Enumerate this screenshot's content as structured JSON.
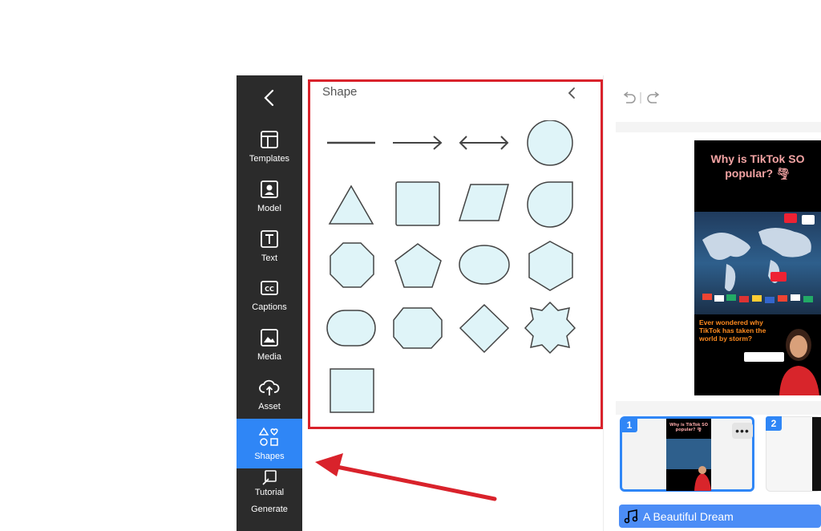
{
  "sidebar": {
    "items": [
      {
        "label": "Templates",
        "icon": "layout-icon"
      },
      {
        "label": "Model",
        "icon": "person-icon"
      },
      {
        "label": "Text",
        "icon": "text-icon"
      },
      {
        "label": "Captions",
        "icon": "captions-icon"
      },
      {
        "label": "Media",
        "icon": "image-icon"
      },
      {
        "label": "Asset",
        "icon": "upload-cloud-icon"
      },
      {
        "label": "Shapes",
        "icon": "shapes-icon",
        "active": true
      },
      {
        "label": "Tutorial",
        "icon": "tutorial-icon"
      },
      {
        "label": "Generate",
        "icon": "generate-icon"
      }
    ]
  },
  "panel": {
    "title": "Shape",
    "shapes": [
      "line",
      "arrow",
      "double-arrow",
      "circle",
      "triangle",
      "square",
      "parallelogram",
      "teardrop",
      "octagon",
      "pentagon",
      "ellipse",
      "hexagon",
      "rounded-rectangle",
      "stretched-hexagon",
      "diamond",
      "starburst",
      "square-2"
    ]
  },
  "editor": {
    "slide": {
      "title": "Why is TikTok SO popular? 🌪",
      "subtitle": "Ever wondered why TikTok has taken the world by storm?"
    },
    "thumbnails": [
      {
        "number": "1",
        "selected": true,
        "more": "•••"
      },
      {
        "number": "2",
        "selected": false
      }
    ],
    "music": {
      "title": "A Beautiful Dream"
    }
  },
  "colors": {
    "sidebar_bg": "#2b2b2b",
    "accent": "#2f86f6",
    "highlight": "#d9222b",
    "shape_fill": "#dff4f8"
  }
}
